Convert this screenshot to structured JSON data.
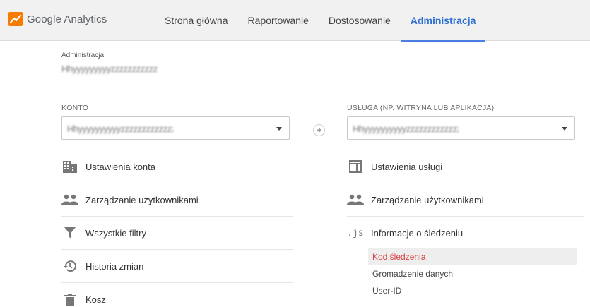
{
  "app": {
    "logo_text": "Google Analytics"
  },
  "nav": {
    "items": [
      {
        "label": "Strona główna",
        "active": false
      },
      {
        "label": "Raportowanie",
        "active": false
      },
      {
        "label": "Dostosowanie",
        "active": false
      },
      {
        "label": "Administracja",
        "active": true
      }
    ]
  },
  "header": {
    "breadcrumb": "Administracja",
    "account_name": "Hhyyyyyyyyyzzzzzzzzzzz"
  },
  "account_column": {
    "label": "KONTO",
    "selected": "Hhyyyyyyyyyyzzzzzzzzzzzzzz",
    "items": [
      {
        "label": "Ustawienia konta",
        "icon": "building-icon"
      },
      {
        "label": "Zarządzanie użytkownikami",
        "icon": "people-icon"
      },
      {
        "label": "Wszystkie filtry",
        "icon": "filter-icon"
      },
      {
        "label": "Historia zmian",
        "icon": "history-icon"
      },
      {
        "label": "Kosz",
        "icon": "trash-icon"
      }
    ]
  },
  "property_column": {
    "label": "USŁUGA (NP. WITRYNA LUB APLIKACJA)",
    "selected": "Hhyyyyyyyyyyzzzzzzzzzzzzzz",
    "items": [
      {
        "label": "Ustawienia usługi",
        "icon": "layout-icon"
      },
      {
        "label": "Zarządzanie użytkownikami",
        "icon": "people-icon"
      },
      {
        "label": "Informacje o śledzeniu",
        "icon": "js-icon",
        "icon_text": ".js"
      }
    ],
    "tracking_subitems": [
      {
        "label": "Kod śledzenia",
        "active": true
      },
      {
        "label": "Gromadzenie danych",
        "active": false
      },
      {
        "label": "User-ID",
        "active": false
      }
    ]
  },
  "colors": {
    "accent": "#2c6fd1",
    "active_sub_text": "#d84242",
    "logo_orange": "#f57c00"
  }
}
